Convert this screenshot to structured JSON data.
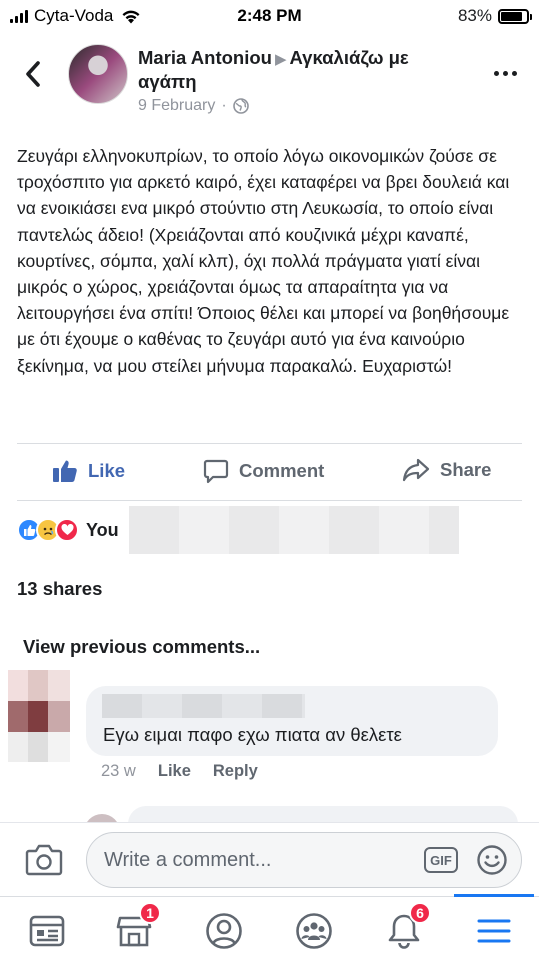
{
  "status_bar": {
    "carrier": "Cyta-Voda",
    "time": "2:48 PM",
    "battery_percent": "83%",
    "battery_level": 0.83
  },
  "post": {
    "author": "Maria Antoniou",
    "group": "Αγκαλιάζω με αγάπη",
    "date": "9 February",
    "privacy_icon": "globe-icon",
    "text": "Ζευγάρι ελληνοκυπρίων, το οποίο λόγω οικονομικών ζούσε σε τροχόσπιτο για αρκετό καιρό, έχει καταφέρει να βρει δουλειά και να ενοικιάσει ενα μικρό στούντιο στη Λευκωσία, το οποίο είναι παντελώς άδειο! (Χρειάζονται από κουζινικά μέχρι καναπέ, κουρτίνες, σόμπα, χαλί κλπ), όχι πολλά πράγματα γιατί είναι μικρός ο χώρος, χρειάζονται όμως τα απαραίτητα για να λειτουργήσει ένα σπίτι! Όποιος θέλει και μπορεί να βοηθήσουμε με ότι έχουμε ο καθένας το ζευγάρι αυτό για ένα καινούριο ξεκίνημα, να μου στείλει μήνυμα παρακαλώ. Ευχαριστώ!"
  },
  "actions": {
    "like": "Like",
    "comment": "Comment",
    "share": "Share",
    "like_color": "#4267b2"
  },
  "reactions": {
    "summary": "You",
    "icons": [
      "like-reaction-icon",
      "sad-reaction-icon",
      "love-reaction-icon"
    ]
  },
  "shares": "13 shares",
  "comments": {
    "view_previous": "View previous comments...",
    "items": [
      {
        "text": "Εγω ειμαι παφο εχω πιατα αν θελετε",
        "time": "23 w",
        "like": "Like",
        "reply": "Reply"
      }
    ]
  },
  "composer": {
    "placeholder": "Write a comment...",
    "gif": "GIF"
  },
  "tabbar": {
    "marketplace_badge": "1",
    "notifications_badge": "6",
    "accent": "#1877f2"
  }
}
